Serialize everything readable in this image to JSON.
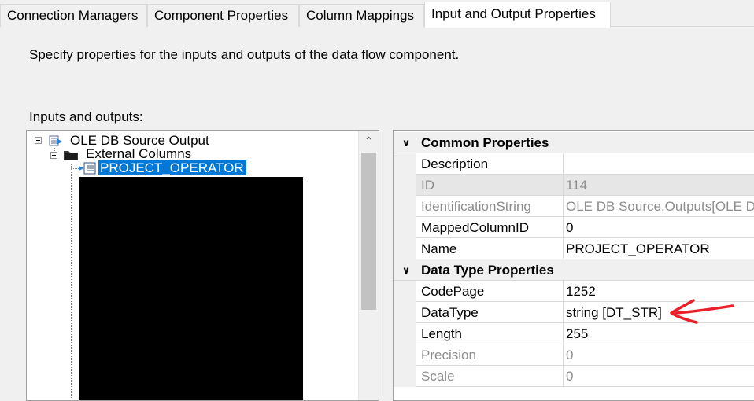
{
  "tabs": [
    {
      "label": "Connection Managers",
      "active": false
    },
    {
      "label": "Component Properties",
      "active": false
    },
    {
      "label": "Column Mappings",
      "active": false
    },
    {
      "label": "Input and Output Properties",
      "active": true
    }
  ],
  "description": "Specify properties for the inputs and outputs of the data flow component.",
  "io_label": "Inputs and outputs:",
  "tree": {
    "root": {
      "label": "OLE DB Source Output",
      "icon": "output-icon"
    },
    "folder": {
      "label": "External Columns",
      "icon": "folder-icon"
    },
    "selected_column": {
      "label": "PROJECT_OPERATOR",
      "icon": "column-icon"
    }
  },
  "properties": {
    "common": {
      "label": "Common Properties",
      "rows": [
        {
          "name": "Description",
          "value": "",
          "readonly": false
        },
        {
          "name": "ID",
          "value": "114",
          "readonly": true
        },
        {
          "name": "IdentificationString",
          "value": "OLE DB Source.Outputs[OLE D",
          "readonly": true
        },
        {
          "name": "MappedColumnID",
          "value": "0",
          "readonly": false
        },
        {
          "name": "Name",
          "value": "PROJECT_OPERATOR",
          "readonly": false
        }
      ]
    },
    "datatype": {
      "label": "Data Type Properties",
      "rows": [
        {
          "name": "CodePage",
          "value": "1252",
          "readonly": false
        },
        {
          "name": "DataType",
          "value": "string [DT_STR]",
          "readonly": false
        },
        {
          "name": "Length",
          "value": "255",
          "readonly": false
        },
        {
          "name": "Precision",
          "value": "0",
          "readonly": true
        },
        {
          "name": "Scale",
          "value": "0",
          "readonly": true
        }
      ]
    }
  },
  "colors": {
    "selection": "#0078d7",
    "annotation_arrow": "#e8202a",
    "readonly_text": "#8d8d8d"
  }
}
